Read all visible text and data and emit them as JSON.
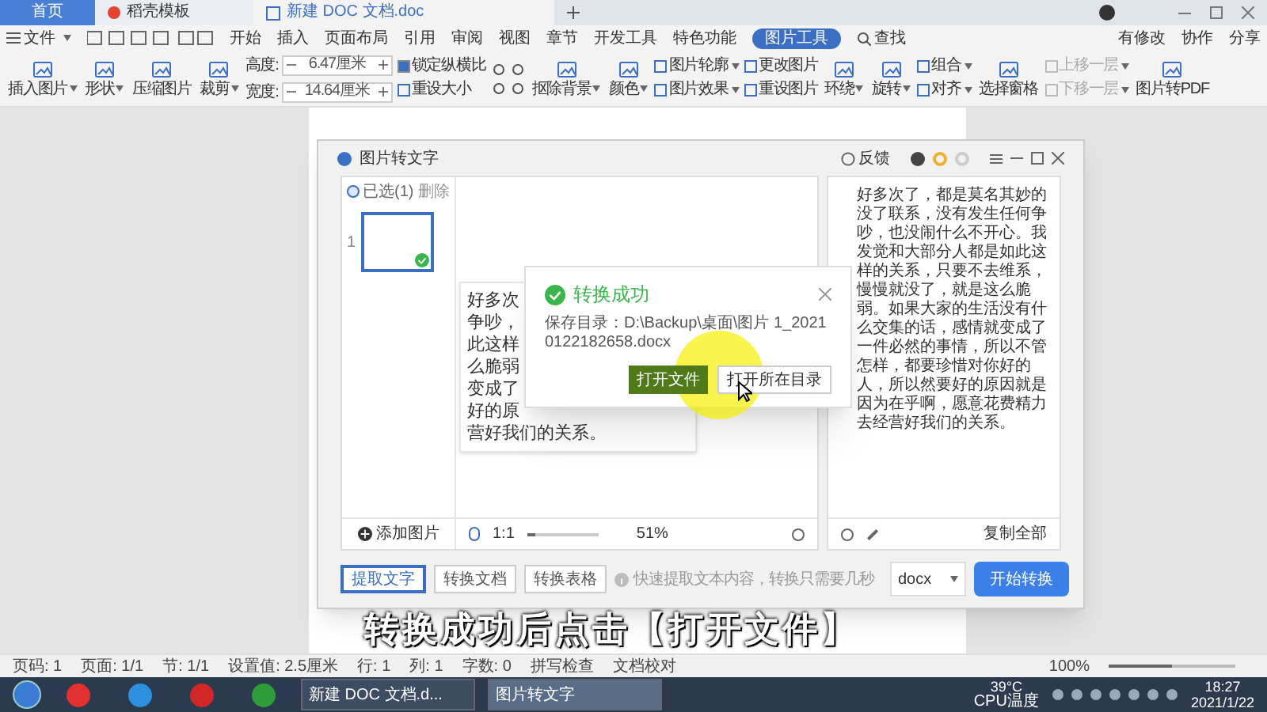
{
  "tabs": [
    {
      "label": "首页",
      "kind": "home",
      "selected": false
    },
    {
      "label": "稻壳模板",
      "kind": "docer",
      "selected": false
    },
    {
      "label": "新建 DOC 文档.doc",
      "kind": "doc",
      "selected": true
    }
  ],
  "menu": {
    "file": "文件",
    "items": [
      {
        "label": "开始",
        "selected": false
      },
      {
        "label": "插入",
        "selected": false
      },
      {
        "label": "页面布局",
        "selected": false
      },
      {
        "label": "引用",
        "selected": false
      },
      {
        "label": "审阅",
        "selected": false
      },
      {
        "label": "视图",
        "selected": false
      },
      {
        "label": "章节",
        "selected": false
      },
      {
        "label": "开发工具",
        "selected": false
      },
      {
        "label": "特色功能",
        "selected": false
      },
      {
        "label": "图片工具",
        "selected": true
      }
    ],
    "search": "查找",
    "right": [
      "有修改",
      "协作",
      "分享"
    ]
  },
  "ribbon": [
    {
      "kind": "big",
      "label": "插入图片",
      "dropdown": true
    },
    {
      "kind": "big",
      "label": "形状",
      "dropdown": true
    },
    {
      "kind": "big",
      "label": "压缩图片",
      "dropdown": false
    },
    {
      "kind": "big",
      "label": "裁剪",
      "dropdown": true
    },
    {
      "kind": "size",
      "rows": [
        {
          "label": "高度:",
          "value": "6.47厘米"
        },
        {
          "label": "宽度:",
          "value": "14.64厘米"
        }
      ]
    },
    {
      "kind": "stack",
      "rows": [
        {
          "label": "锁定纵横比",
          "kind": "check",
          "checked": true
        },
        {
          "label": "重设大小",
          "kind": "button",
          "dropdown": false,
          "disabled": false
        }
      ]
    },
    {
      "kind": "tools"
    },
    {
      "kind": "big",
      "label": "抠除背景",
      "dropdown": true
    },
    {
      "kind": "big",
      "label": "颜色",
      "dropdown": true
    },
    {
      "kind": "stack",
      "rows": [
        {
          "label": "图片轮廓",
          "kind": "button",
          "dropdown": true,
          "disabled": false
        },
        {
          "label": "图片效果",
          "kind": "button",
          "dropdown": true,
          "disabled": false
        }
      ]
    },
    {
      "kind": "stack",
      "rows": [
        {
          "label": "更改图片",
          "kind": "button",
          "dropdown": false,
          "disabled": false
        },
        {
          "label": "重设图片",
          "kind": "button",
          "dropdown": false,
          "disabled": false
        }
      ]
    },
    {
      "kind": "big",
      "label": "环绕",
      "dropdown": true
    },
    {
      "kind": "big",
      "label": "旋转",
      "dropdown": true
    },
    {
      "kind": "stack",
      "rows": [
        {
          "label": "组合",
          "kind": "button",
          "dropdown": true,
          "disabled": false
        },
        {
          "label": "对齐",
          "kind": "button",
          "dropdown": true,
          "disabled": false
        }
      ]
    },
    {
      "kind": "big",
      "label": "选择窗格",
      "dropdown": false
    },
    {
      "kind": "stack",
      "rows": [
        {
          "label": "上移一层",
          "kind": "button",
          "dropdown": true,
          "disabled": true
        },
        {
          "label": "下移一层",
          "kind": "button",
          "dropdown": true,
          "disabled": true
        }
      ]
    },
    {
      "kind": "big",
      "label": "图片转PDF",
      "dropdown": false
    }
  ],
  "dialog": {
    "title": "图片转文字",
    "feedback": "反馈",
    "list": {
      "select_all": "已选(1)",
      "checked": true,
      "delete": "删除",
      "thumbs": [
        {
          "number": "1",
          "selected": true
        }
      ],
      "add": "添加图片"
    },
    "preview": {
      "lines": [
        "好多次",
        "争吵，",
        "此这样",
        "么脆弱",
        "变成了",
        "好的原",
        "营好我们的关系。"
      ],
      "ratio": "1:1",
      "zoom": {
        "level": 0.12
      },
      "percent": "51%"
    },
    "result": {
      "text": "好多次了，都是莫名其妙的没了联系，没有发生任何争吵，也没闹什么不开心。我发觉和大部分人都是如此这样的关系，只要不去维系，慢慢就没了，就是这么脆弱。如果大家的生活没有什么交集的话，感情就变成了一件必然的事情，所以不管怎样，都要珍惜对你好的人，所以然要好的原因就是因为在乎啊，愿意花费精力去经营好我们的关系。",
      "copy": "复制全部"
    },
    "modes": [
      {
        "label": "提取文字",
        "selected": true
      },
      {
        "label": "转换文档",
        "selected": false
      },
      {
        "label": "转换表格",
        "selected": false
      }
    ],
    "hint": "快速提取文本内容，转换只需要几秒",
    "format": "docx",
    "start": "开始转换"
  },
  "popup": {
    "title": "转换成功",
    "path": "保存目录：D:\\Backup\\桌面\\图片 1_20210122182658.docx",
    "buttons": [
      {
        "label": "打开文件",
        "primary": true
      },
      {
        "label": "打开所在目录",
        "primary": false
      }
    ]
  },
  "caption": "转换成功后点击【打开文件】",
  "status_bar": {
    "items": [
      "页码: 1",
      "页面: 1/1",
      "节: 1/1",
      "设置值: 2.5厘米",
      "行: 1",
      "列: 1",
      "字数: 0"
    ],
    "spell": "拼写检查",
    "proof": "文档校对",
    "zoom": "100%",
    "zoom_level": {
      "level": 0.5
    }
  },
  "taskbar": {
    "windows": [
      {
        "label": "新建 DOC 文档.d...",
        "selected": false
      },
      {
        "label": "图片转文字",
        "selected": true
      }
    ],
    "temp": "39°C",
    "temp_label": "CPU温度",
    "time": "18:27",
    "date": "2021/1/22"
  }
}
